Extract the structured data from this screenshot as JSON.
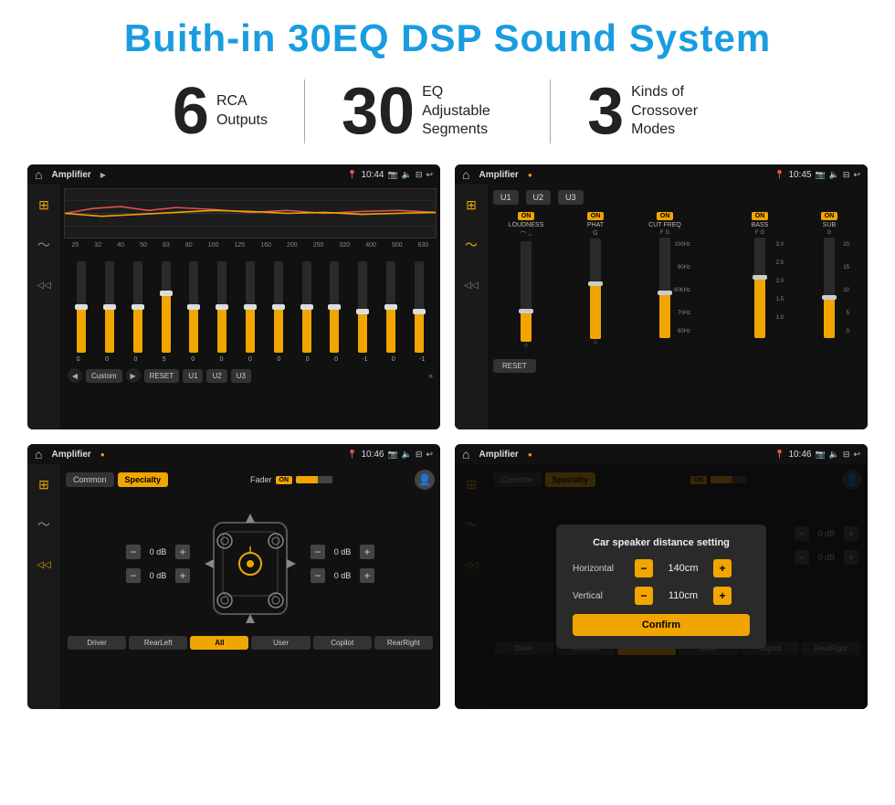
{
  "title": "Buith-in 30EQ DSP Sound System",
  "stats": [
    {
      "number": "6",
      "text": "RCA\nOutputs"
    },
    {
      "number": "30",
      "text": "EQ Adjustable\nSegments"
    },
    {
      "number": "3",
      "text": "Kinds of\nCrossover Modes"
    }
  ],
  "screens": [
    {
      "id": "screen1",
      "statusTitle": "Amplifier",
      "statusTime": "10:44",
      "description": "EQ Equalizer screen"
    },
    {
      "id": "screen2",
      "statusTitle": "Amplifier",
      "statusTime": "10:45",
      "description": "Crossover screen"
    },
    {
      "id": "screen3",
      "statusTitle": "Amplifier",
      "statusTime": "10:46",
      "description": "Fader/Speaker screen"
    },
    {
      "id": "screen4",
      "statusTitle": "Amplifier",
      "statusTime": "10:46",
      "description": "Distance setting dialog"
    }
  ],
  "eq": {
    "bands": [
      "25",
      "32",
      "40",
      "50",
      "63",
      "80",
      "100",
      "125",
      "160",
      "200",
      "250",
      "320",
      "400",
      "500",
      "630"
    ],
    "values": [
      "0",
      "0",
      "0",
      "5",
      "0",
      "0",
      "0",
      "0",
      "0",
      "0",
      "-1",
      "0",
      "-1"
    ],
    "buttons": [
      "Custom",
      "RESET",
      "U1",
      "U2",
      "U3"
    ]
  },
  "crossover": {
    "presets": [
      "U1",
      "U2",
      "U3"
    ],
    "channels": [
      {
        "label": "LOUDNESS",
        "on": true
      },
      {
        "label": "PHAT",
        "on": true
      },
      {
        "label": "CUT FREQ",
        "on": true
      },
      {
        "label": "BASS",
        "on": true
      },
      {
        "label": "SUB",
        "on": true
      }
    ]
  },
  "fader": {
    "tabs": [
      "Common",
      "Specialty"
    ],
    "faderLabel": "Fader",
    "onLabel": "ON",
    "dbValues": [
      "0 dB",
      "0 dB",
      "0 dB",
      "0 dB"
    ],
    "bottomButtons": [
      "Driver",
      "RearLeft",
      "All",
      "User",
      "Copilot",
      "RearRight"
    ]
  },
  "dialog": {
    "title": "Car speaker distance setting",
    "horizontal": {
      "label": "Horizontal",
      "value": "140cm"
    },
    "vertical": {
      "label": "Vertical",
      "value": "110cm"
    },
    "confirmLabel": "Confirm"
  }
}
